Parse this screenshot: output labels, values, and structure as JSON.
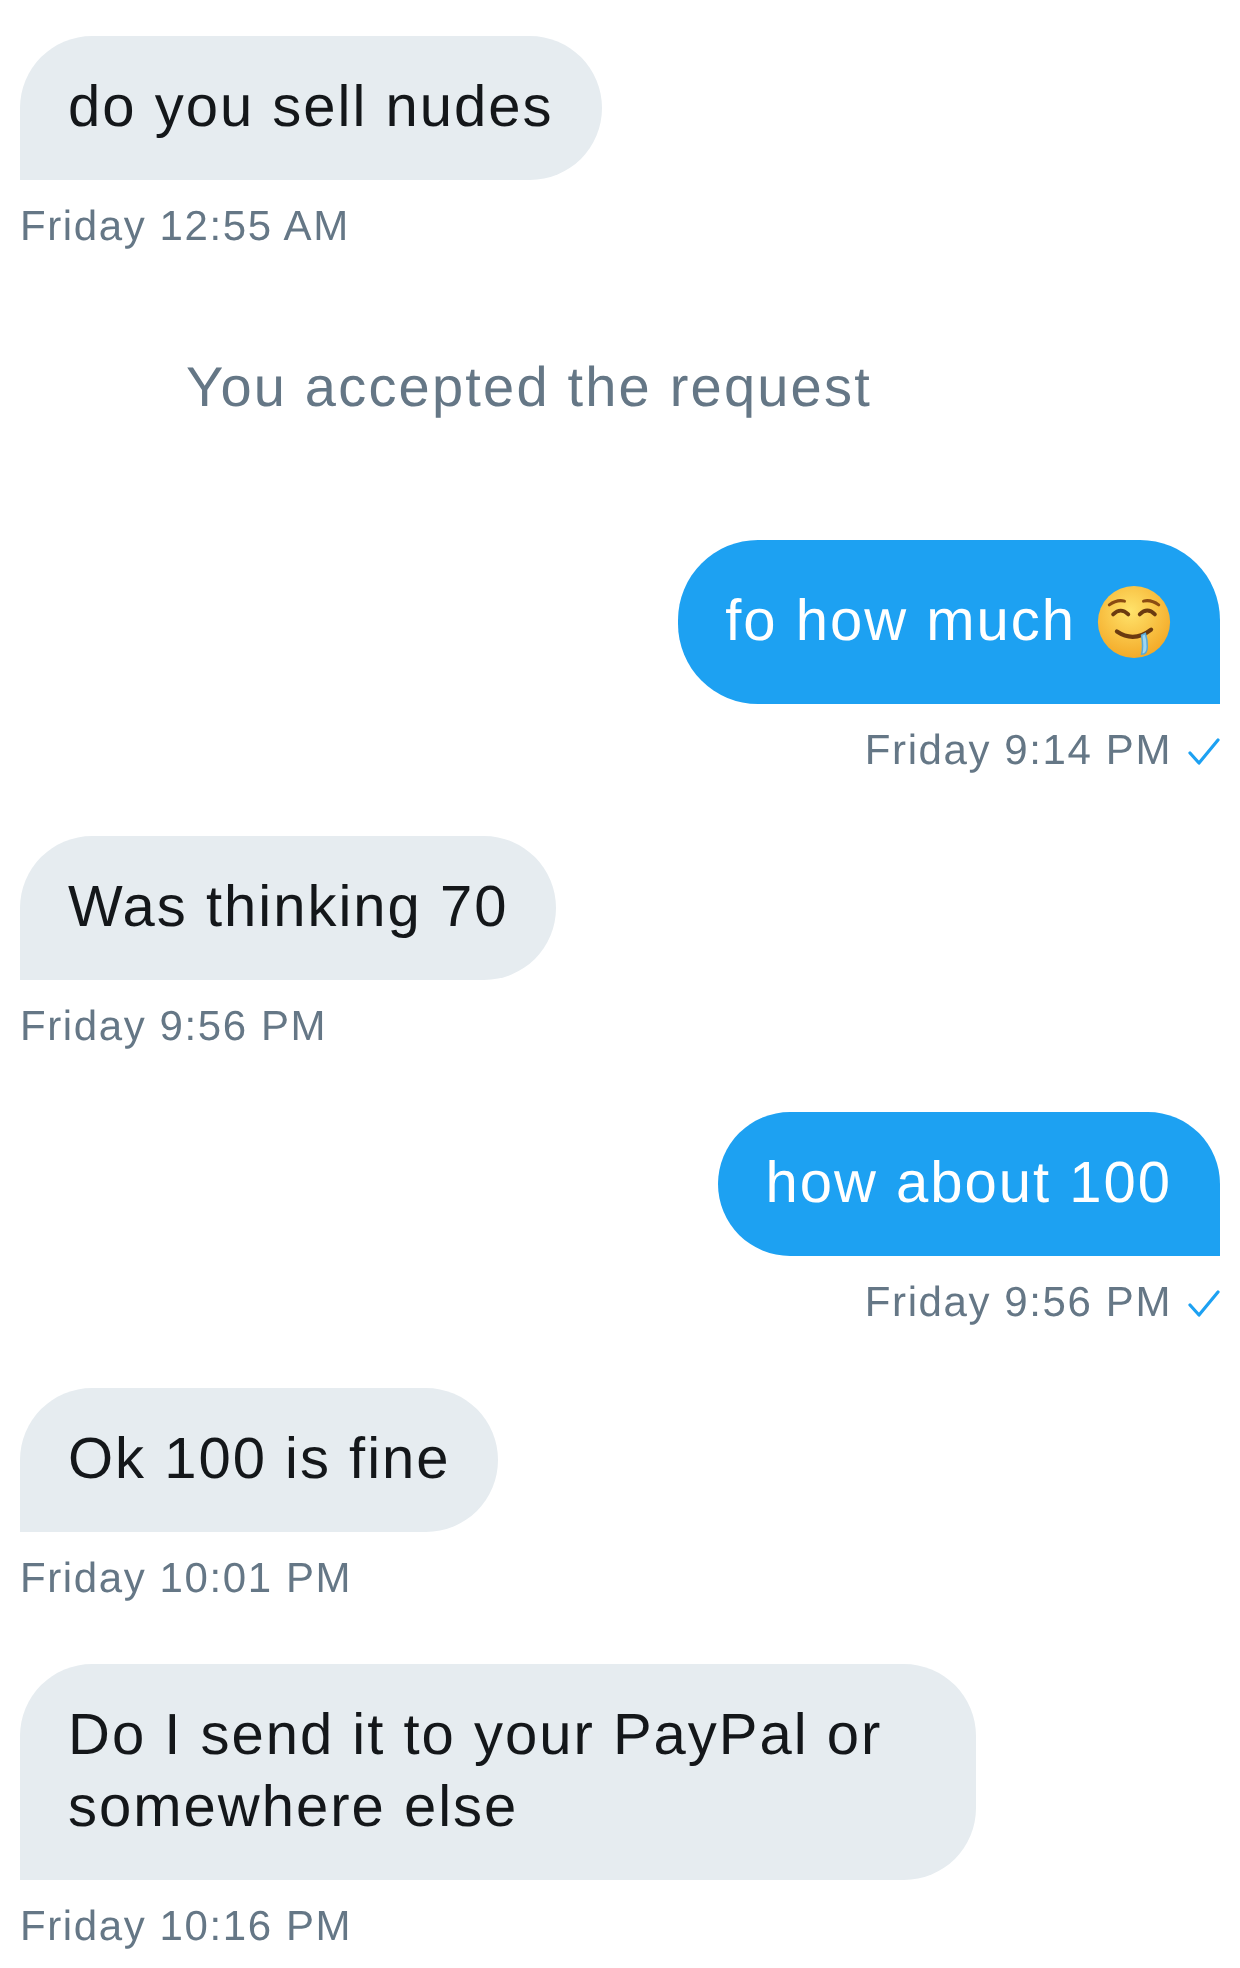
{
  "messages": [
    {
      "kind": "incoming",
      "text": "do you sell nudes",
      "emoji": false,
      "timestamp": "Friday 12:55 AM"
    },
    {
      "kind": "event",
      "text": "You accepted the request"
    },
    {
      "kind": "outgoing",
      "text": "fo how much",
      "emoji": true,
      "timestamp": "Friday 9:14 PM",
      "delivered": true
    },
    {
      "kind": "incoming",
      "text": "Was thinking 70",
      "emoji": false,
      "timestamp": "Friday 9:56 PM"
    },
    {
      "kind": "outgoing",
      "text": "how about 100",
      "emoji": false,
      "timestamp": "Friday 9:56 PM",
      "delivered": true
    },
    {
      "kind": "incoming",
      "text": "Ok 100 is fine",
      "emoji": false,
      "timestamp": "Friday 10:01 PM"
    },
    {
      "kind": "incoming",
      "text": "Do I send it to your PayPal or somewhere else",
      "emoji": false,
      "timestamp": "Friday 10:16 PM"
    }
  ]
}
